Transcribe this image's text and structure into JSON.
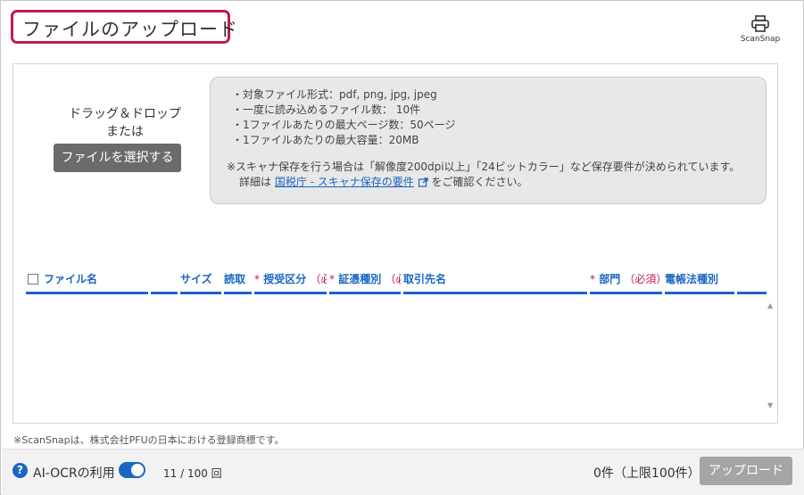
{
  "header": {
    "title": "ファイルのアップロード",
    "scansnap_label": "ScanSnap",
    "scansnap_icon": "printer-icon"
  },
  "dropzone": {
    "drag_text": "ドラッグ＆ドロップ",
    "or_text": "または",
    "select_button": "ファイルを選択する"
  },
  "info": {
    "items": [
      "対象ファイル形式：pdf, png, jpg, jpeg",
      "一度に読み込めるファイル数： 10件",
      "1ファイルあたりの最大ページ数：50ページ",
      "1ファイルあたりの最大容量：20MB"
    ],
    "note": "※スキャナ保存を行う場合は「解像度200dpi以上」「24ビットカラー」など保存要件が決められています。",
    "detail_prefix": "詳細は",
    "link_text": "国税庁 - スキャナ保存の要件",
    "detail_suffix": "をご確認ください。"
  },
  "table": {
    "columns": [
      {
        "label": "ファイル名",
        "required": false
      },
      {
        "label": "",
        "required": false
      },
      {
        "label": "サイズ",
        "required": false
      },
      {
        "label": "読取",
        "required": false
      },
      {
        "label": "授受区分",
        "required": true,
        "note": "（必"
      },
      {
        "label": "証憑種別",
        "required": true,
        "note": "（必"
      },
      {
        "label": "取引先名",
        "required": false
      },
      {
        "label": "部門",
        "required": true,
        "note": "（必須）"
      },
      {
        "label": "電帳法種別",
        "required": false
      },
      {
        "label": "",
        "required": false
      }
    ],
    "required_mark": "*"
  },
  "trademark": "※ScanSnapは、株式会社PFUの日本における登録商標です。",
  "footer": {
    "help_icon_text": "?",
    "ai_ocr_label": "AI-OCRの利用",
    "ai_ocr_enabled": true,
    "usage_text": "11 / 100 回",
    "count_text": "0件（上限100件）",
    "upload_button": "アップロード"
  },
  "colors": {
    "accent": "#1a66c2",
    "title_border": "#c0185a",
    "required": "#c0185a",
    "select_button_bg": "#6b6b6b",
    "upload_button_bg": "#a5a5a5"
  }
}
